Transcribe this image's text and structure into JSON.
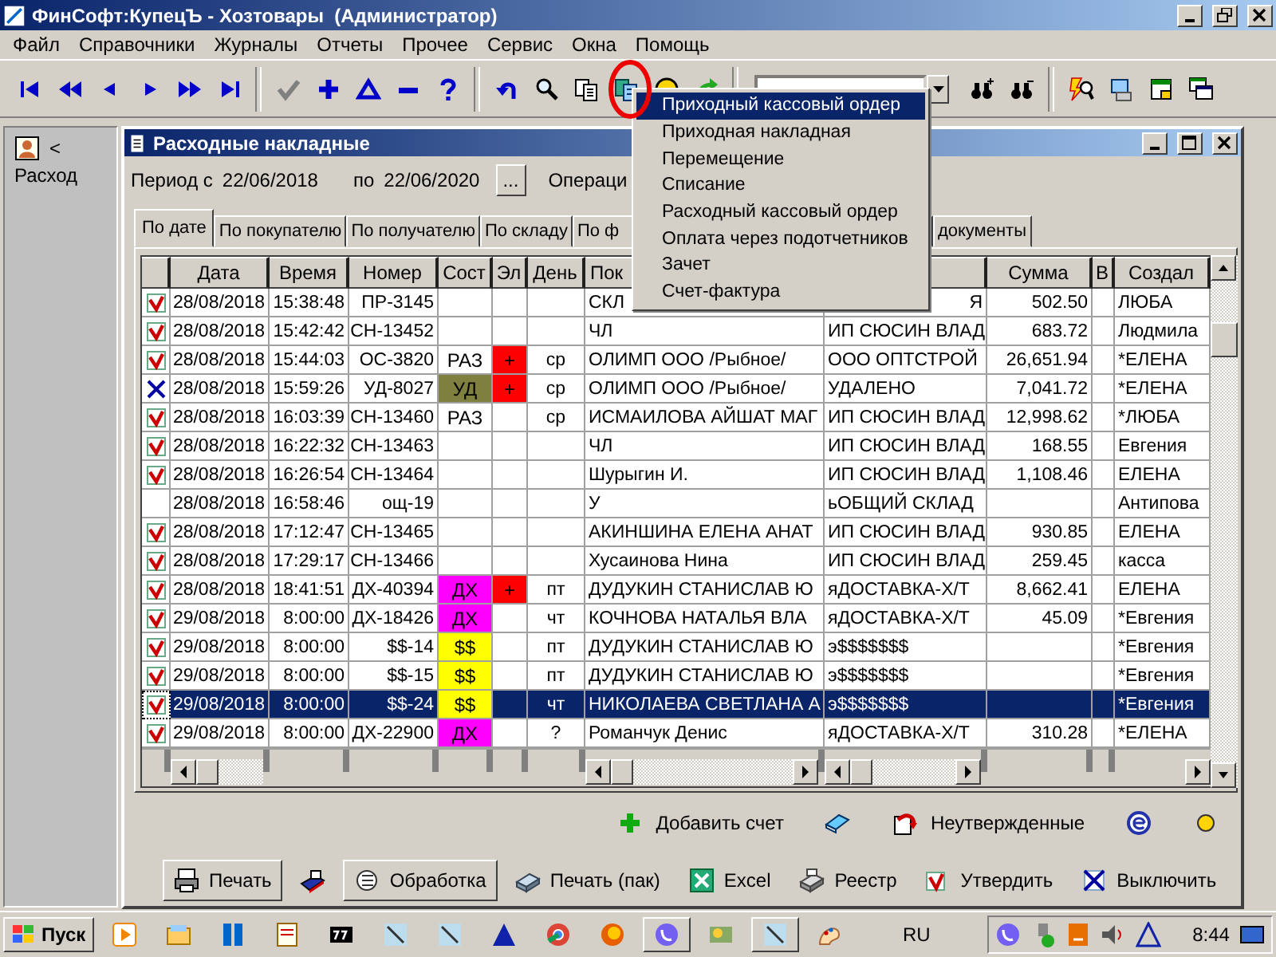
{
  "window": {
    "title": "ФинСофт:КупецЪ - Хозтовары  (Администратор)"
  },
  "menu": [
    "Файл",
    "Справочники",
    "Журналы",
    "Отчеты",
    "Прочее",
    "Сервис",
    "Окна",
    "Помощь"
  ],
  "side_panel": {
    "arrow": "<",
    "label": "Расход"
  },
  "doc_window": {
    "title": "Расходные накладные",
    "period": {
      "from_label": "Период с",
      "from": "22/06/2018",
      "to_label": "по",
      "to": "22/06/2020",
      "more": "...",
      "operation_label": "Операци"
    },
    "tabs": [
      {
        "label": "По дате",
        "selected": true
      },
      {
        "label": "По покупателю",
        "selected": false
      },
      {
        "label": "По получателю",
        "selected": false
      },
      {
        "label": "По складу",
        "selected": false
      },
      {
        "label": "По ф",
        "selected": false
      },
      {
        "label": "документы",
        "selected": false
      }
    ],
    "table": {
      "columns": [
        "Дата",
        "Время",
        "Номер",
        "Сост",
        "Эл",
        "День",
        "Пок",
        "Сумма",
        "В",
        "Создал"
      ],
      "rows": [
        {
          "kind": "approved",
          "date": "28/08/2018",
          "time": "15:38:48",
          "number": "ПР-3145",
          "pok": "СКЛ",
          "column_9": "Я",
          "sum": "502.50",
          "created": "ЛЮБА",
          "selected": false
        },
        {
          "kind": "approved",
          "date": "28/08/2018",
          "time": "15:42:42",
          "number": "СН-13452",
          "pok": "ЧЛ",
          "column_9": "ИП СЮСИН ВЛАД",
          "sum": "683.72",
          "created": "Людмила",
          "selected": false
        },
        {
          "kind": "approved",
          "date": "28/08/2018",
          "time": "15:44:03",
          "number": "ОС-3820",
          "state": {
            "text": "РАЗ"
          },
          "el": {
            "text": "+",
            "color": "#ff0000"
          },
          "day": "ср",
          "pok": "ОЛИМП ООО /Рыбное/",
          "column_9": "ООО ОПТСТРОЙ",
          "sum": "26,651.94",
          "created": "*ЕЛЕНА",
          "selected": false
        },
        {
          "kind": "deleted",
          "date": "28/08/2018",
          "time": "15:59:26",
          "number": "УД-8027",
          "state": {
            "text": "УД",
            "color": "#7f7f40"
          },
          "el": {
            "text": "+",
            "color": "#ff0000"
          },
          "day": "ср",
          "pok": "ОЛИМП ООО /Рыбное/",
          "column_9": "УДАЛЕНО",
          "sum": "7,041.72",
          "created": "*ЕЛЕНА",
          "selected": false
        },
        {
          "kind": "approved",
          "date": "28/08/2018",
          "time": "16:03:39",
          "number": "СН-13460",
          "state": {
            "text": "РАЗ"
          },
          "day": "ср",
          "pok": "ИСМАИЛОВА АЙШАТ МАГ",
          "column_9": "ИП СЮСИН ВЛАД",
          "sum": "12,998.62",
          "created": "*ЛЮБА",
          "selected": false
        },
        {
          "kind": "approved",
          "date": "28/08/2018",
          "time": "16:22:32",
          "number": "СН-13463",
          "pok": "ЧЛ",
          "column_9": "ИП СЮСИН ВЛАД",
          "sum": "168.55",
          "created": "Евгения",
          "selected": false
        },
        {
          "kind": "approved",
          "date": "28/08/2018",
          "time": "16:26:54",
          "number": "СН-13464",
          "pok": "Шурыгин И.",
          "column_9": "ИП СЮСИН ВЛАД",
          "sum": "1,108.46",
          "created": "ЕЛЕНА",
          "selected": false
        },
        {
          "kind": "plain",
          "date": "28/08/2018",
          "time": "16:58:46",
          "number": "ощ-19",
          "pok": "У",
          "column_9": "ьОБЩИЙ СКЛАД",
          "created": "Антипова",
          "selected": false
        },
        {
          "kind": "approved",
          "date": "28/08/2018",
          "time": "17:12:47",
          "number": "СН-13465",
          "pok": "АКИНШИНА ЕЛЕНА АНАТ",
          "column_9": "ИП СЮСИН ВЛАД",
          "sum": "930.85",
          "created": "ЕЛЕНА",
          "selected": false
        },
        {
          "kind": "approved",
          "date": "28/08/2018",
          "time": "17:29:17",
          "number": "СН-13466",
          "pok": "Хусаинова Нина",
          "column_9": "ИП СЮСИН ВЛАД",
          "sum": "259.45",
          "created": "касса",
          "selected": false
        },
        {
          "kind": "approved",
          "date": "28/08/2018",
          "time": "18:41:51",
          "number": "ДХ-40394",
          "state": {
            "text": "ДХ",
            "color": "#ff00ff"
          },
          "el": {
            "text": "+",
            "color": "#ff0000"
          },
          "day": "пт",
          "pok": "ДУДУКИН СТАНИСЛАВ Ю",
          "column_9": "яДОСТАВКА-Х/Т",
          "sum": "8,662.41",
          "created": "ЕЛЕНА",
          "selected": false
        },
        {
          "kind": "approved",
          "date": "29/08/2018",
          "time": "8:00:00",
          "number": "ДХ-18426",
          "state": {
            "text": "ДХ",
            "color": "#ff00ff"
          },
          "day": "чт",
          "pok": "КОЧНОВА НАТАЛЬЯ ВЛА",
          "column_9": "яДОСТАВКА-Х/Т",
          "sum": "45.09",
          "created": "*Евгения",
          "selected": false
        },
        {
          "kind": "approved",
          "date": "29/08/2018",
          "time": "8:00:00",
          "number": "$$-14",
          "state": {
            "text": "$$",
            "color": "#ffff00"
          },
          "day": "пт",
          "pok": "ДУДУКИН СТАНИСЛАВ Ю",
          "column_9": "э$$$$$$$",
          "created": "*Евгения",
          "selected": false
        },
        {
          "kind": "approved",
          "date": "29/08/2018",
          "time": "8:00:00",
          "number": "$$-15",
          "state": {
            "text": "$$",
            "color": "#ffff00"
          },
          "day": "пт",
          "pok": "ДУДУКИН СТАНИСЛАВ Ю",
          "column_9": "э$$$$$$$",
          "created": "*Евгения",
          "selected": false
        },
        {
          "kind": "approved",
          "date": "29/08/2018",
          "time": "8:00:00",
          "number": "$$-24",
          "state": {
            "text": "$$",
            "color": "#ffff00"
          },
          "day": "чт",
          "pok": "НИКОЛАЕВА СВЕТЛАНА А",
          "column_9": "э$$$$$$$",
          "created": "*Евгения",
          "selected": true
        },
        {
          "kind": "approved",
          "date": "29/08/2018",
          "time": "8:00:00",
          "number": "ДХ-22900",
          "state": {
            "text": "ДХ",
            "color": "#ff00ff"
          },
          "day": "?",
          "pok": "Романчук Денис",
          "column_9": "яДОСТАВКА-Х/Т",
          "sum": "310.28",
          "created": "*ЕЛЕНА",
          "selected": false
        }
      ]
    },
    "actions": [
      {
        "kind": "add",
        "label": "Добавить счет"
      },
      {
        "kind": "book"
      },
      {
        "kind": "unapproved",
        "label": "Неутвержденные"
      },
      {
        "kind": "web"
      },
      {
        "kind": "dot"
      }
    ],
    "buttons": [
      {
        "kind": "print",
        "label": "Печать",
        "raised": true
      },
      {
        "kind": "fax"
      },
      {
        "kind": "process",
        "label": "Обработка",
        "raised": true
      },
      {
        "kind": "batch-print",
        "label": "Печать (пак)",
        "raised": false
      },
      {
        "kind": "excel",
        "label": "Excel",
        "raised": false
      },
      {
        "kind": "registry",
        "label": "Реестр",
        "raised": false
      },
      {
        "kind": "approve",
        "label": "Утвердить",
        "raised": false
      },
      {
        "kind": "disable",
        "label": "Выключить",
        "raised": false
      }
    ]
  },
  "context_menu": {
    "items": [
      {
        "label": "Приходный кассовый ордер",
        "selected": true
      },
      {
        "label": "Приходная накладная",
        "selected": false
      },
      {
        "label": "Перемещение",
        "selected": false
      },
      {
        "label": "Списание",
        "selected": false
      },
      {
        "label": "Расходный кассовый ордер",
        "selected": false
      },
      {
        "label": "Оплата через подотчетников",
        "selected": false
      },
      {
        "label": "Зачет",
        "selected": false
      },
      {
        "label": "Счет-фактура",
        "selected": false
      }
    ]
  },
  "taskbar": {
    "start": "Пуск",
    "language": "RU",
    "clock": "8:44"
  }
}
